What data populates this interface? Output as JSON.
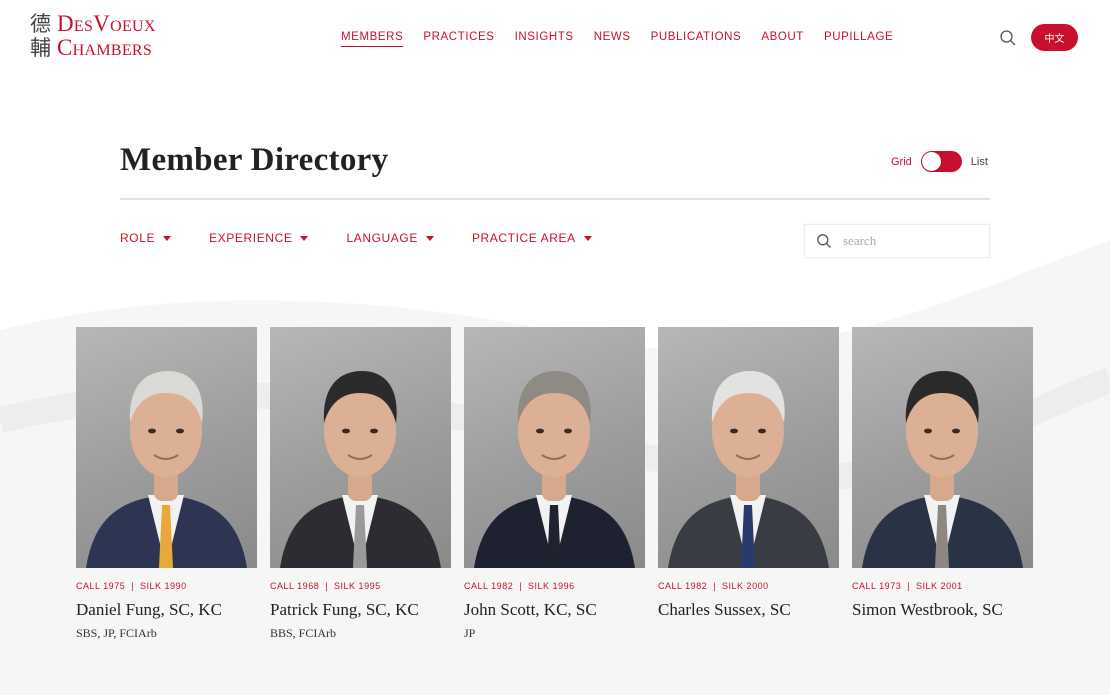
{
  "brand": {
    "cjk_top": "德",
    "cjk_bottom": "輔",
    "name_line1": "DesVoeux",
    "name_line2": "Chambers",
    "accent_color": "#c8102e"
  },
  "nav": {
    "items": [
      {
        "label": "MEMBERS",
        "active": true
      },
      {
        "label": "PRACTICES",
        "active": false
      },
      {
        "label": "INSIGHTS",
        "active": false
      },
      {
        "label": "NEWS",
        "active": false
      },
      {
        "label": "PUBLICATIONS",
        "active": false
      },
      {
        "label": "ABOUT",
        "active": false
      },
      {
        "label": "PUPILLAGE",
        "active": false
      }
    ],
    "search_icon": "search-icon",
    "language_button": "中文"
  },
  "page": {
    "title": "Member Directory",
    "view_toggle": {
      "left_label": "Grid",
      "right_label": "List",
      "selected": "List"
    }
  },
  "filters": {
    "items": [
      {
        "label": "ROLE"
      },
      {
        "label": "EXPERIENCE"
      },
      {
        "label": "LANGUAGE"
      },
      {
        "label": "PRACTICE AREA"
      }
    ],
    "search": {
      "placeholder": "search",
      "value": ""
    }
  },
  "members": [
    {
      "call": "CALL 1975",
      "silk": "SILK 1990",
      "name": "Daniel Fung, SC, KC",
      "honours": "SBS, JP, FCIArb",
      "hair": "#d9d9d6",
      "tie": "#e9a83a",
      "suit": "#2e3552"
    },
    {
      "call": "CALL 1968",
      "silk": "SILK 1995",
      "name": "Patrick Fung, SC, KC",
      "honours": "BBS, FCIArb",
      "hair": "#2b2b2b",
      "tie": "#9a9a9a",
      "suit": "#2c2c32"
    },
    {
      "call": "CALL 1982",
      "silk": "SILK 1996",
      "name": "John Scott, KC, SC",
      "honours": "JP",
      "hair": "#8e8a84",
      "tie": "#1f2330",
      "suit": "#1e2230"
    },
    {
      "call": "CALL 1982",
      "silk": "SILK 2000",
      "name": "Charles Sussex, SC",
      "honours": "",
      "hair": "#e2e2e0",
      "tie": "#2a3a6a",
      "suit": "#3a3c44"
    },
    {
      "call": "CALL 1973",
      "silk": "SILK 2001",
      "name": "Simon Westbrook, SC",
      "honours": "",
      "hair": "#2a2a2a",
      "tie": "#8e8680",
      "suit": "#2a3245"
    }
  ]
}
